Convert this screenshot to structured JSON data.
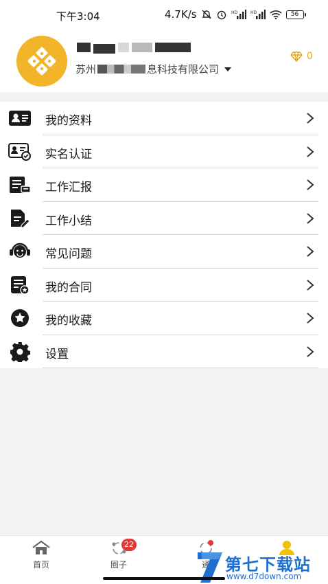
{
  "status_bar": {
    "time": "下午3:04",
    "speed": "4.7K/s",
    "battery": "56"
  },
  "profile": {
    "company": "苏州",
    "company_suffix": "息科技有限公司",
    "diamond_count": "0"
  },
  "menu": [
    {
      "label": "我的资料",
      "icon": "id-card-icon"
    },
    {
      "label": "实名认证",
      "icon": "verified-id-icon"
    },
    {
      "label": "工作汇报",
      "icon": "work-report-icon"
    },
    {
      "label": "工作小结",
      "icon": "document-edit-icon"
    },
    {
      "label": "常见问题",
      "icon": "customer-service-icon"
    },
    {
      "label": "我的合同",
      "icon": "contract-icon"
    },
    {
      "label": "我的收藏",
      "icon": "star-icon"
    },
    {
      "label": "设置",
      "icon": "gear-icon"
    }
  ],
  "tabs": [
    {
      "label": "首页"
    },
    {
      "label": "圈子",
      "badge": "22"
    },
    {
      "label": "通"
    },
    {
      "label": ""
    }
  ],
  "watermark": {
    "title": "第七下载站",
    "url": "www.d7down.com"
  },
  "colors": {
    "accent": "#e7a31c",
    "badge": "#e53935",
    "watermark": "#1f6fd1"
  }
}
